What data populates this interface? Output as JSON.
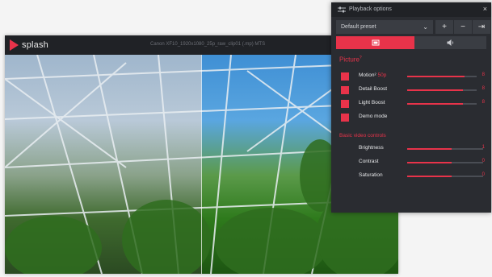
{
  "player": {
    "logo_text": "splash",
    "file_name": "Canon XF10_1920x1080_25p_raw_clip01 (.mp) MTS"
  },
  "panel": {
    "title": "Playback options",
    "close_glyph": "×",
    "preset": {
      "value": "Default preset",
      "chevron": "⌄"
    },
    "preset_buttons": {
      "add": "+",
      "remove": "−",
      "export": "⇥"
    },
    "tabs": [
      {
        "name": "picture",
        "icon": "picture-icon",
        "active": true
      },
      {
        "name": "audio",
        "icon": "speaker-icon",
        "active": false
      }
    ],
    "section_title": "Picture",
    "section_marker": "?",
    "options": [
      {
        "label": "Motion",
        "hint": "50p",
        "level": 0.82,
        "value": "8"
      },
      {
        "label": "Detail Boost",
        "hint": "",
        "level": 0.8,
        "value": "8"
      },
      {
        "label": "Light Boost",
        "hint": "",
        "level": 0.8,
        "value": "8"
      },
      {
        "label": "Demo mode",
        "hint": "",
        "level": null,
        "value": ""
      }
    ],
    "basic_title": "Basic video controls",
    "basic": [
      {
        "label": "Brightness",
        "level": 0.58,
        "value": "1"
      },
      {
        "label": "Contrast",
        "level": 0.58,
        "value": "0"
      },
      {
        "label": "Saturation",
        "level": 0.58,
        "value": "0"
      }
    ]
  },
  "colors": {
    "accent": "#e8334a",
    "panel": "#2a2c31",
    "control": "#3a3d43"
  }
}
